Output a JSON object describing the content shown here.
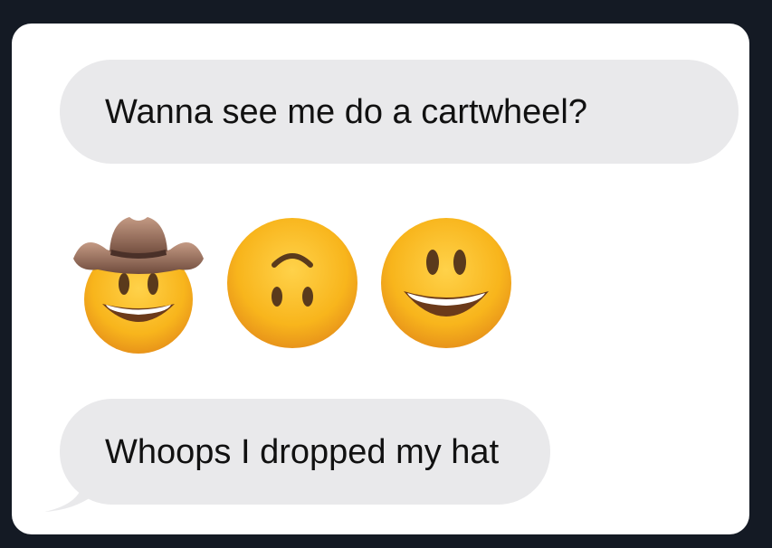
{
  "messages": [
    {
      "text": "Wanna see me do a cartwheel?"
    },
    {
      "emojis": [
        "cowboy-hat-face",
        "upside-down-face",
        "grinning-face-with-big-eyes"
      ]
    },
    {
      "text": "Whoops I dropped my hat"
    }
  ],
  "colors": {
    "bubble": "#e9e9eb",
    "background": "#141a24",
    "card": "#ffffff"
  }
}
